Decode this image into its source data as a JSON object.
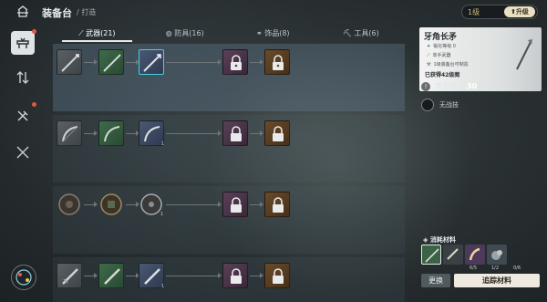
{
  "header": {
    "title": "装备台",
    "breadcrumb": "/ 打造",
    "level": "1级",
    "upgrade_label": "升级"
  },
  "tabs": [
    {
      "label": "武器(21)",
      "icon": "sword-icon",
      "active": true
    },
    {
      "label": "防具(16)",
      "icon": "shield-icon",
      "active": false
    },
    {
      "label": "饰品(8)",
      "icon": "ring-icon",
      "active": false
    },
    {
      "label": "工具(6)",
      "icon": "pickaxe-icon",
      "active": false
    }
  ],
  "sidebar": [
    {
      "name": "workbench-icon",
      "active": true,
      "badge": true
    },
    {
      "name": "exchange-icon",
      "active": false,
      "badge": false
    },
    {
      "name": "tools-icon",
      "active": false,
      "badge": true
    },
    {
      "name": "crossed-swords-icon",
      "active": false,
      "badge": false
    }
  ],
  "detail": {
    "name": "牙角长矛",
    "attributes": [
      "锻化等级 0",
      "单手武器",
      "1级装备台可制造"
    ],
    "owned": "已获得42级图",
    "stat_label": "攻击力",
    "stat_value": "30",
    "skill": "无战技"
  },
  "materials": {
    "title": "消耗材料",
    "counts": [
      "",
      "6/5",
      "1/2",
      "0/6"
    ],
    "swap_label": "更换",
    "track_label": "追踪材料"
  },
  "grid": {
    "mini_counts": [
      "1",
      "1",
      "1"
    ]
  },
  "colors": {
    "selection": "#3fd2e6",
    "badge": "#e05a3c",
    "rarity_green": "#3f6b4a",
    "rarity_blue": "#4a5872",
    "rarity_purple": "#5a4058",
    "rarity_orange": "#6a4a2a"
  }
}
